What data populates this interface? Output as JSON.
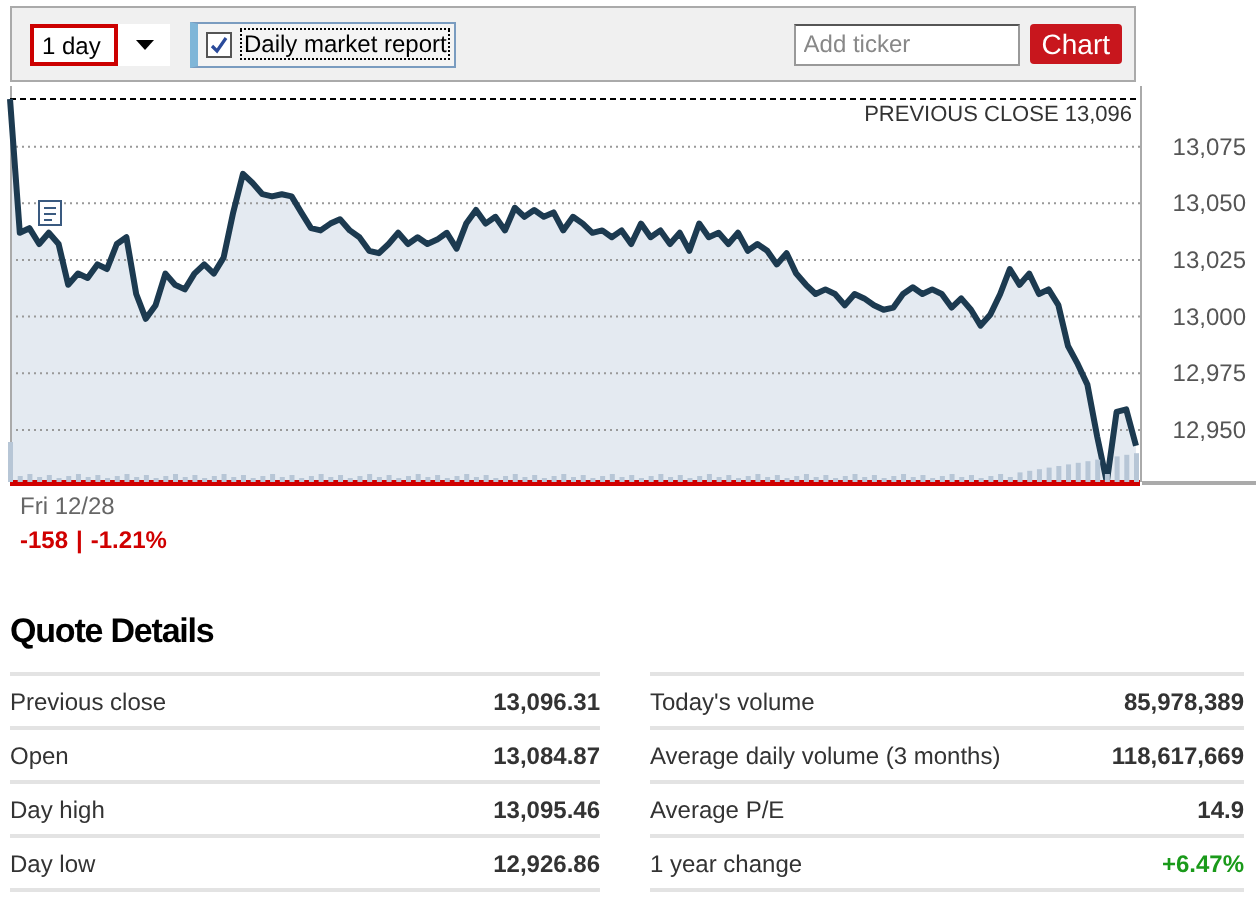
{
  "toolbar": {
    "range": {
      "value": "1 day"
    },
    "report": {
      "label": "Daily market report",
      "checked": true
    },
    "ticker": {
      "placeholder": "Add ticker"
    },
    "chart_button": "Chart"
  },
  "chart": {
    "chart_data": {
      "type": "area",
      "ylim": [
        12927,
        13100
      ],
      "yticks": [
        {
          "value": 13075,
          "label": "13,075"
        },
        {
          "value": 13050,
          "label": "13,050"
        },
        {
          "value": 13025,
          "label": "13,025"
        },
        {
          "value": 13000,
          "label": "13,000"
        },
        {
          "value": 12975,
          "label": "12,975"
        },
        {
          "value": 12950,
          "label": "12,950"
        }
      ],
      "grid": true,
      "ref_lines": [
        {
          "axis": "y",
          "value": 13096,
          "label": "PREVIOUS CLOSE 13,096"
        }
      ],
      "values": [
        13096,
        13037,
        13039,
        13032,
        13037,
        13032,
        13014,
        13019,
        13017,
        13023,
        13021,
        13032,
        13035,
        13010,
        12999,
        13005,
        13019,
        13014,
        13012,
        13019,
        13023,
        13019,
        13026,
        13046,
        13063,
        13059,
        13054,
        13053,
        13054,
        13053,
        13046,
        13039,
        13038,
        13041,
        13043,
        13038,
        13035,
        13029,
        13028,
        13032,
        13037,
        13032,
        13035,
        13032,
        13034,
        13037,
        13030,
        13041,
        13047,
        13041,
        13044,
        13038,
        13048,
        13044,
        13047,
        13044,
        13046,
        13038,
        13044,
        13041,
        13037,
        13038,
        13035,
        13038,
        13032,
        13041,
        13035,
        13038,
        13032,
        13037,
        13029,
        13041,
        13035,
        13037,
        13032,
        13037,
        13029,
        13032,
        13029,
        13023,
        13028,
        13019,
        13014,
        13010,
        13012,
        13010,
        13005,
        13010,
        13008,
        13005,
        13003,
        13004,
        13010,
        13013,
        13010,
        13012,
        13010,
        13004,
        13008,
        13003,
        12996,
        13001,
        13010,
        13021,
        13014,
        13019,
        13010,
        13012,
        13005,
        12987,
        12979,
        12970,
        12947,
        12927,
        12958,
        12959,
        12943
      ]
    },
    "date": "Fri 12/28",
    "change": "-158",
    "separator": "|",
    "change_percent": "-1.21%"
  },
  "quote_details": {
    "title": "Quote Details",
    "left": [
      {
        "label": "Previous close",
        "value": "13,096.31"
      },
      {
        "label": "Open",
        "value": "13,084.87"
      },
      {
        "label": "Day high",
        "value": "13,095.46"
      },
      {
        "label": "Day low",
        "value": "12,926.86"
      }
    ],
    "right": [
      {
        "label": "Today's volume",
        "value": "85,978,389"
      },
      {
        "label": "Average daily volume (3 months)",
        "value": "118,617,669"
      },
      {
        "label": "Average P/E",
        "value": "14.9"
      },
      {
        "label": "1 year change",
        "value": "+6.47%",
        "color": "#1a9a1a"
      }
    ]
  }
}
